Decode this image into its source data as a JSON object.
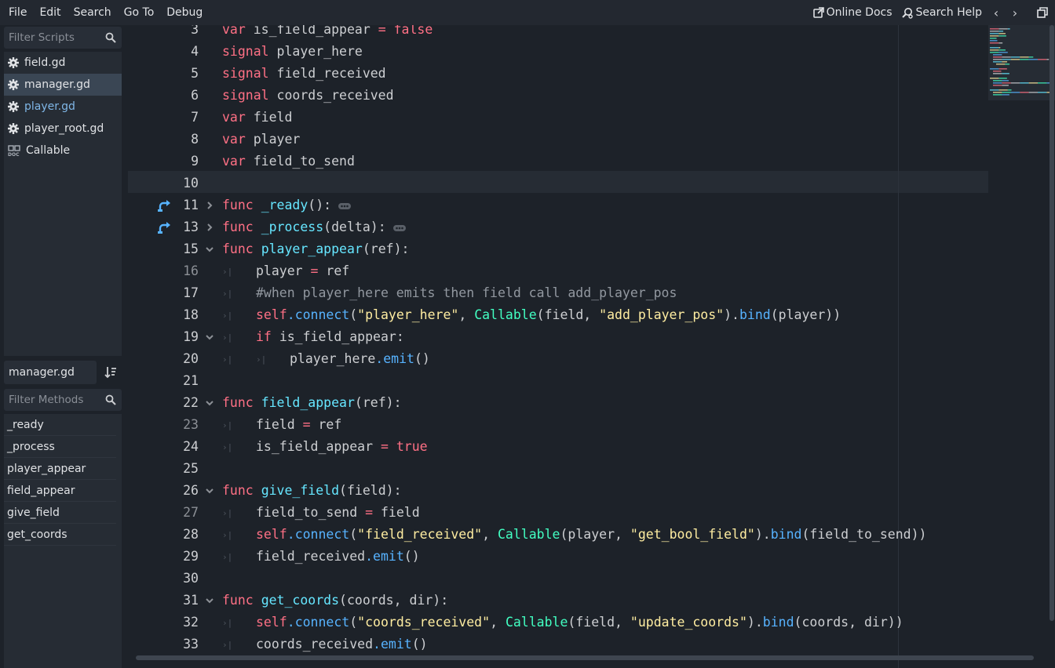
{
  "menu": [
    "File",
    "Edit",
    "Search",
    "Go To",
    "Debug"
  ],
  "topright": {
    "online_docs": "Online Docs",
    "search_help": "Search Help",
    "back_arrow": "‹",
    "forward_arrow": "›"
  },
  "scripts": {
    "filter_placeholder": "Filter Scripts",
    "items": [
      {
        "label": "field.gd",
        "icon": "gear-icon"
      },
      {
        "label": "manager.gd",
        "icon": "gear-icon"
      },
      {
        "label": "player.gd",
        "icon": "gear-icon"
      },
      {
        "label": "player_root.gd",
        "icon": "gear-icon"
      },
      {
        "label": "Callable",
        "icon": "doc-icon"
      }
    ]
  },
  "current_script": "manager.gd",
  "methods": {
    "filter_placeholder": "Filter Methods",
    "items": [
      "_ready",
      "_process",
      "player_appear",
      "field_appear",
      "give_field",
      "get_coords"
    ]
  },
  "code_lines": [
    {
      "n": "3",
      "text": "var is_field_appear = false"
    },
    {
      "n": "4",
      "text": "signal player_here"
    },
    {
      "n": "5",
      "text": "signal field_received"
    },
    {
      "n": "6",
      "text": "signal coords_received"
    },
    {
      "n": "7",
      "text": "var field"
    },
    {
      "n": "8",
      "text": "var player"
    },
    {
      "n": "9",
      "text": "var field_to_send"
    },
    {
      "n": "10",
      "text": ""
    },
    {
      "n": "11",
      "text": "func _ready():"
    },
    {
      "n": "13",
      "text": "func _process(delta):"
    },
    {
      "n": "15",
      "text": "func player_appear(ref):"
    },
    {
      "n": "16",
      "text": "player = ref"
    },
    {
      "n": "17",
      "text": "#when player_here emits then field call add_player_pos"
    },
    {
      "n": "18",
      "text": "self.connect(\"player_here\", Callable(field, \"add_player_pos\").bind(player))"
    },
    {
      "n": "19",
      "text": "if is_field_appear:"
    },
    {
      "n": "20",
      "text": "player_here.emit()"
    },
    {
      "n": "21",
      "text": ""
    },
    {
      "n": "22",
      "text": "func field_appear(ref):"
    },
    {
      "n": "23",
      "text": "field = ref"
    },
    {
      "n": "24",
      "text": "is_field_appear = true"
    },
    {
      "n": "25",
      "text": ""
    },
    {
      "n": "26",
      "text": "func give_field(field):"
    },
    {
      "n": "27",
      "text": "field_to_send = field"
    },
    {
      "n": "28",
      "text": "self.connect(\"field_received\", Callable(player, \"get_bool_field\").bind(field_to_send))"
    },
    {
      "n": "29",
      "text": "field_received.emit()"
    },
    {
      "n": "30",
      "text": ""
    },
    {
      "n": "31",
      "text": "func get_coords(coords, dir):"
    },
    {
      "n": "32",
      "text": "self.connect(\"coords_received\", Callable(field, \"update_coords\").bind(coords, dir))"
    },
    {
      "n": "33",
      "text": "coords_received.emit()"
    }
  ],
  "colors": {
    "keyword": "#ff7085",
    "function": "#66e6ff",
    "string": "#ffeda1",
    "class": "#42ffc2",
    "comment": "#9298a0",
    "selected_bg": "#3a4654"
  }
}
